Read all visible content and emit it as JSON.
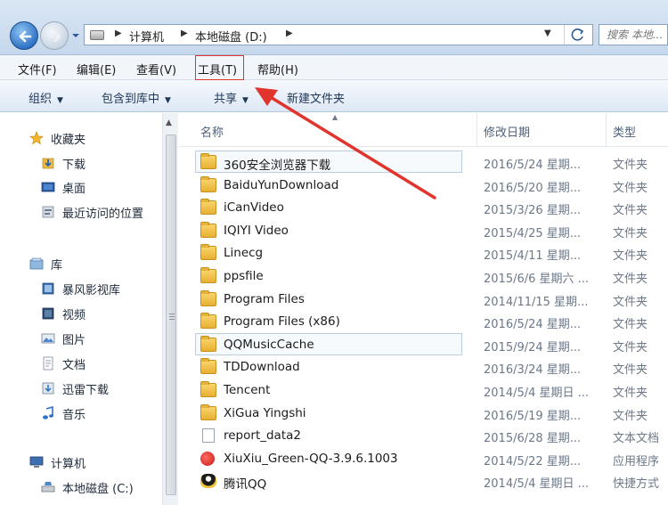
{
  "address": {
    "crumbs": [
      "计算机",
      "本地磁盘 (D:)"
    ],
    "search_placeholder": "搜索 本地..."
  },
  "menu": [
    "文件(F)",
    "编辑(E)",
    "查看(V)",
    "工具(T)",
    "帮助(H)"
  ],
  "commands": [
    "组织",
    "包含到库中",
    "共享",
    "新建文件夹"
  ],
  "nav": {
    "favorites": {
      "label": "收藏夹",
      "items": [
        "下载",
        "桌面",
        "最近访问的位置"
      ]
    },
    "libraries": {
      "label": "库",
      "items": [
        "暴风影视库",
        "视频",
        "图片",
        "文档",
        "迅雷下载",
        "音乐"
      ]
    },
    "computer": {
      "label": "计算机",
      "items": [
        "本地磁盘 (C:)"
      ]
    }
  },
  "columns": {
    "name": "名称",
    "date": "修改日期",
    "type": "类型"
  },
  "files": [
    {
      "name": "360安全浏览器下载",
      "date": "2016/5/24 星期...",
      "type": "文件夹",
      "icon": "folder-icon",
      "selected": true
    },
    {
      "name": "BaiduYunDownload",
      "date": "2016/5/20 星期...",
      "type": "文件夹",
      "icon": "folder-icon"
    },
    {
      "name": "iCanVideo",
      "date": "2015/3/26 星期...",
      "type": "文件夹",
      "icon": "folder-icon"
    },
    {
      "name": "IQIYI Video",
      "date": "2015/4/25 星期...",
      "type": "文件夹",
      "icon": "folder-icon"
    },
    {
      "name": "Linecg",
      "date": "2015/4/11 星期...",
      "type": "文件夹",
      "icon": "folder-icon"
    },
    {
      "name": "ppsfile",
      "date": "2015/6/6 星期六 ...",
      "type": "文件夹",
      "icon": "folder-icon"
    },
    {
      "name": "Program Files",
      "date": "2014/11/15 星期...",
      "type": "文件夹",
      "icon": "folder-icon"
    },
    {
      "name": "Program Files (x86)",
      "date": "2016/5/24 星期...",
      "type": "文件夹",
      "icon": "folder-icon"
    },
    {
      "name": "QQMusicCache",
      "date": "2015/9/24 星期...",
      "type": "文件夹",
      "icon": "folder-icon",
      "selected": true
    },
    {
      "name": "TDDownload",
      "date": "2016/3/24 星期...",
      "type": "文件夹",
      "icon": "folder-icon"
    },
    {
      "name": "Tencent",
      "date": "2014/5/4 星期日 ...",
      "type": "文件夹",
      "icon": "folder-icon"
    },
    {
      "name": "XiGua Yingshi",
      "date": "2016/5/19 星期...",
      "type": "文件夹",
      "icon": "folder-icon"
    },
    {
      "name": "report_data2",
      "date": "2015/6/28 星期...",
      "type": "文本文档",
      "icon": "text-file-icon"
    },
    {
      "name": "XiuXiu_Green-QQ-3.9.6.1003",
      "date": "2014/5/22 星期...",
      "type": "应用程序",
      "icon": "app-icon"
    },
    {
      "name": "腾讯QQ",
      "date": "2014/5/4 星期日 ...",
      "type": "快捷方式",
      "icon": "qq-shortcut-icon"
    }
  ],
  "colors": {
    "highlight_box": "#e0342d",
    "arrow": "#e0342d",
    "accent": "#2f73c4"
  }
}
